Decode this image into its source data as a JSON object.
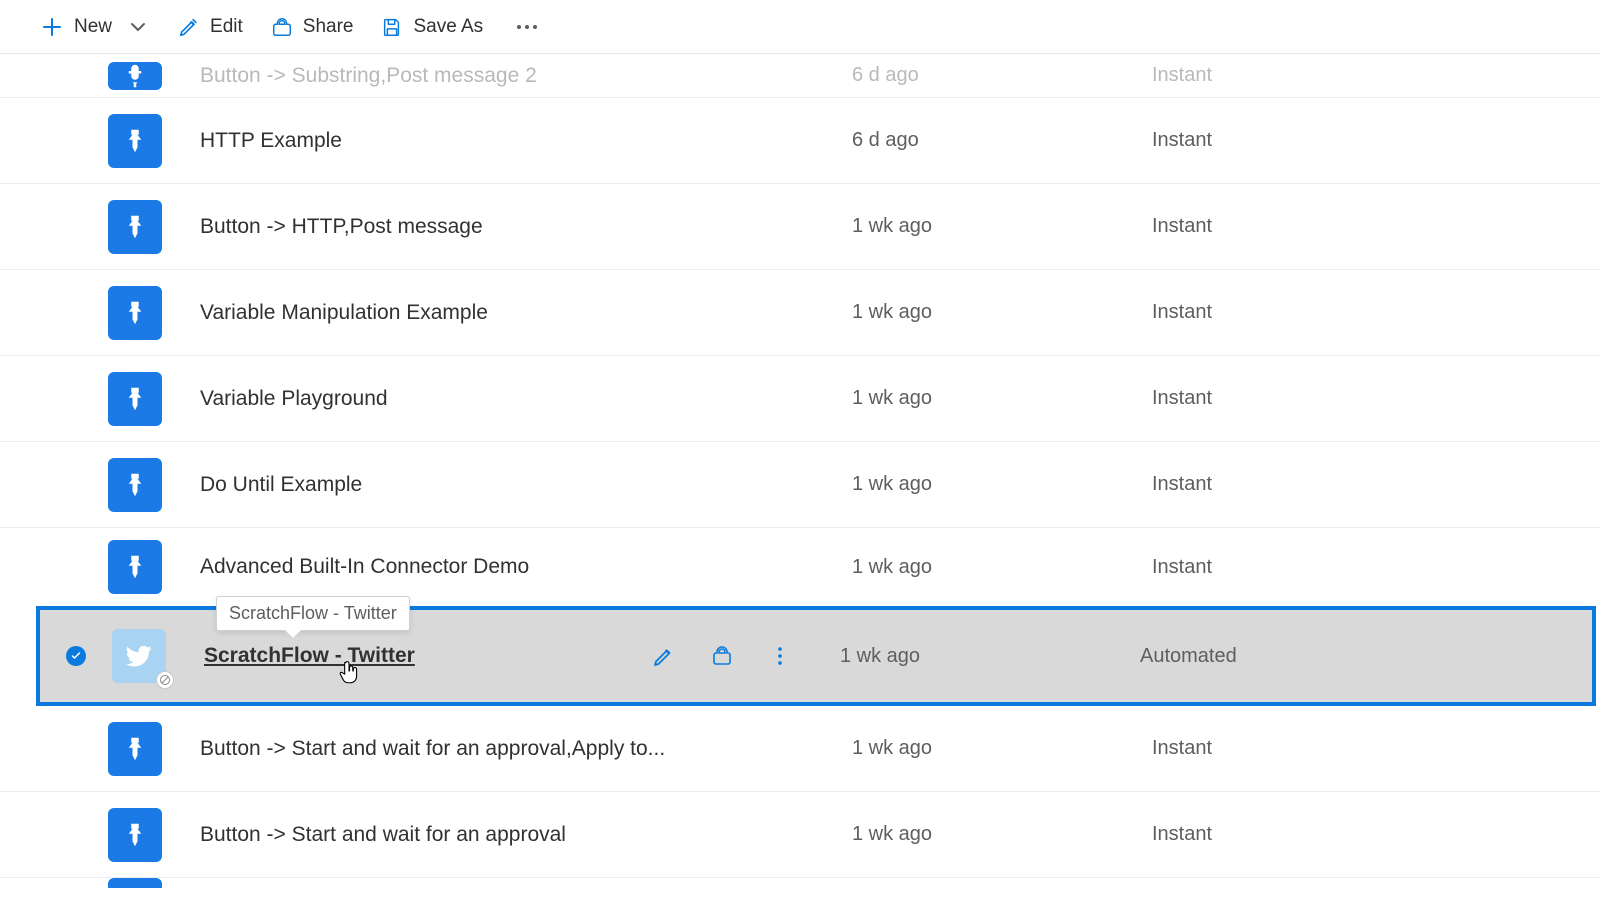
{
  "toolbar": {
    "new": "New",
    "edit": "Edit",
    "share": "Share",
    "save_as": "Save As"
  },
  "tooltip": "ScratchFlow - Twitter",
  "rows": [
    {
      "name": "Button -> Substring,Post message 2",
      "time": "6 d ago",
      "type": "Instant",
      "icon": "button",
      "partial": true
    },
    {
      "name": "HTTP Example",
      "time": "6 d ago",
      "type": "Instant",
      "icon": "button"
    },
    {
      "name": "Button -> HTTP,Post message",
      "time": "1 wk ago",
      "type": "Instant",
      "icon": "button"
    },
    {
      "name": "Variable Manipulation Example",
      "time": "1 wk ago",
      "type": "Instant",
      "icon": "button"
    },
    {
      "name": "Variable Playground",
      "time": "1 wk ago",
      "type": "Instant",
      "icon": "button"
    },
    {
      "name": "Do Until Example",
      "time": "1 wk ago",
      "type": "Instant",
      "icon": "button"
    },
    {
      "name": "Advanced Built-In Connector Demo",
      "time": "1 wk ago",
      "type": "Instant",
      "icon": "button"
    },
    {
      "name": "ScratchFlow - Twitter",
      "time": "1 wk ago",
      "type": "Automated",
      "icon": "twitter",
      "selected": true
    },
    {
      "name": "Button -> Start and wait for an approval,Apply to...",
      "time": "1 wk ago",
      "type": "Instant",
      "icon": "button"
    },
    {
      "name": "Button -> Start and wait for an approval",
      "time": "1 wk ago",
      "type": "Instant",
      "icon": "button"
    }
  ]
}
